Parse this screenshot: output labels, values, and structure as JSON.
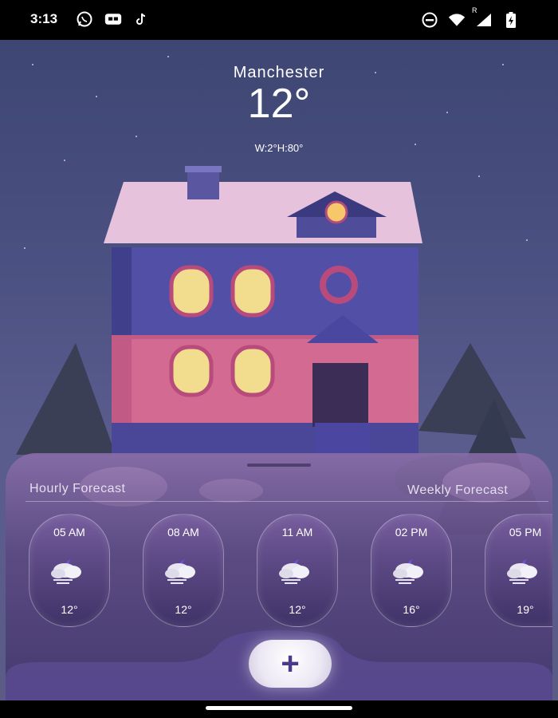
{
  "status_bar": {
    "time": "3:13",
    "left_icons": [
      "whatsapp-icon",
      "message-icon",
      "tiktok-icon"
    ],
    "right_icons": [
      "do-not-disturb-icon",
      "wifi-icon",
      "signal-icon",
      "battery-charging-icon"
    ],
    "roaming_label": "R"
  },
  "weather": {
    "city": "Manchester",
    "temperature": "12°",
    "wind_humidity": "W:2°H:80°"
  },
  "forecast": {
    "tabs": [
      "Hourly Forecast",
      "Weekly Forecast"
    ],
    "hourly": [
      {
        "time": "05 AM",
        "temp": "12°",
        "icon": "night-cloud-snow-icon"
      },
      {
        "time": "08 AM",
        "temp": "12°",
        "icon": "night-cloud-snow-icon"
      },
      {
        "time": "11 AM",
        "temp": "12°",
        "icon": "night-cloud-snow-icon"
      },
      {
        "time": "02 PM",
        "temp": "16°",
        "icon": "night-cloud-snow-icon"
      },
      {
        "time": "05 PM",
        "temp": "19°",
        "icon": "night-cloud-snow-icon"
      }
    ]
  },
  "actions": {
    "add_label": "+"
  },
  "colors": {
    "sky": "#4b5182",
    "accent": "#4b3a8a",
    "sheet": "#5c4a82"
  }
}
